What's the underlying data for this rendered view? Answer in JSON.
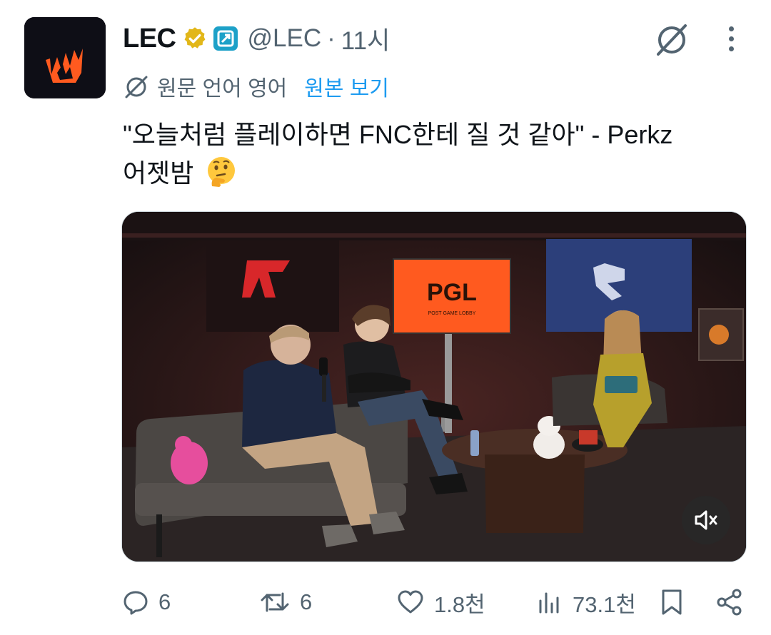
{
  "author": {
    "name": "LEC",
    "handle": "@LEC",
    "separator": "·",
    "time": "11시",
    "verified_icon": "gold-verified-badge-icon",
    "affiliate_icon": "affiliate-badge-icon"
  },
  "translation": {
    "label": "원문 언어 영어",
    "show_original": "원본 보기"
  },
  "tweet": {
    "line1": "\"오늘처럼 플레이하면 FNC한테 질 것 같아\" - Perkz",
    "line2": "어젯밤",
    "emoji": "thinking-face-emoji"
  },
  "media": {
    "type": "video",
    "screen_text": "PGL",
    "screen_subtext": "POST GAME LOBBY",
    "mute_icon": "muted-speaker-icon"
  },
  "actions": {
    "replies": "6",
    "reposts": "6",
    "likes": "1.8천",
    "views": "73.1천"
  },
  "colors": {
    "accent": "#1d9bf0",
    "secondary_text": "#536471",
    "verified_gold": "#e2b719",
    "lec_orange": "#ff5a1f"
  }
}
